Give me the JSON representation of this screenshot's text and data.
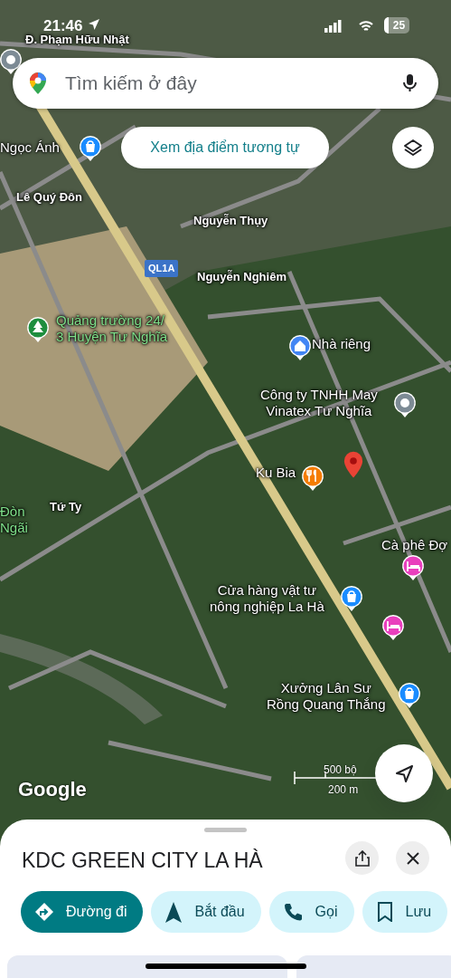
{
  "status_bar": {
    "time": "21:46",
    "battery": "25"
  },
  "search": {
    "placeholder": "Tìm kiếm ở đây"
  },
  "similar_chip": {
    "label": "Xem địa điểm tương tự"
  },
  "map_labels": [
    {
      "kind": "road",
      "lines": [
        "Đ. Phạm Hữu Nhật"
      ]
    },
    {
      "kind": "place",
      "lines": [
        "Ngọc Ánh"
      ],
      "pin": {
        "kind": "shop",
        "color": "#1a8cff"
      }
    },
    {
      "kind": "road",
      "lines": [
        "Lê Quý Đôn"
      ]
    },
    {
      "kind": "road",
      "lines": [
        "Nguyễn Thụy"
      ]
    },
    {
      "kind": "shield",
      "lines": [
        "QL1A"
      ]
    },
    {
      "kind": "road",
      "lines": [
        "Nguyễn Nghiêm"
      ]
    },
    {
      "kind": "park",
      "lines": [
        "Quảng trường 24/",
        "3 Huyện Tư Nghĩa"
      ],
      "pin": {
        "kind": "park",
        "color": "#1e8e3e"
      }
    },
    {
      "kind": "place",
      "lines": [
        "Nhà riêng"
      ],
      "pin": {
        "kind": "home",
        "color": "#4285f4"
      }
    },
    {
      "kind": "place",
      "lines": [
        "Công ty TNHH May",
        "Vinatex Tư Nghĩa"
      ],
      "pin": {
        "kind": "place",
        "color": "#7d8b95"
      }
    },
    {
      "kind": "place",
      "lines": [
        "Ku Bia"
      ],
      "pin": {
        "kind": "food",
        "color": "#f57c00"
      }
    },
    {
      "kind": "road",
      "lines": [
        "Tứ Ty"
      ]
    },
    {
      "kind": "park",
      "lines": [
        "Đòn",
        "Ngãi"
      ]
    },
    {
      "kind": "place",
      "lines": [
        "Cà phê Đợ"
      ]
    },
    {
      "kind": "place",
      "lines": [
        "Cửa hàng vật tư",
        "nông nghiệp La Hà"
      ],
      "pin": {
        "kind": "shop",
        "color": "#1a8cff"
      }
    },
    {
      "kind": "place",
      "lines": [
        "Xưởng Lân Sư",
        "Rồng Quang Thắng"
      ],
      "pin": {
        "kind": "shop",
        "color": "#1a8cff"
      }
    }
  ],
  "pins": [
    {
      "kind": "place",
      "color": "#7d8b95"
    },
    {
      "kind": "hotel",
      "color": "#e93fbd"
    },
    {
      "kind": "hotel",
      "color": "#e93fbd"
    },
    {
      "kind": "marker",
      "color": "#ea4335"
    }
  ],
  "map_footer": {
    "logo": "Google",
    "scale_imperial": "500 bộ",
    "scale_metric": "200 m"
  },
  "sheet": {
    "title": "KDC GREEN CITY LA HÀ",
    "actions": [
      {
        "kind": "directions",
        "label": "Đường đi"
      },
      {
        "kind": "start",
        "label": "Bắt đầu"
      },
      {
        "kind": "call",
        "label": "Gọi"
      },
      {
        "kind": "save",
        "label": "Lưu"
      }
    ]
  }
}
